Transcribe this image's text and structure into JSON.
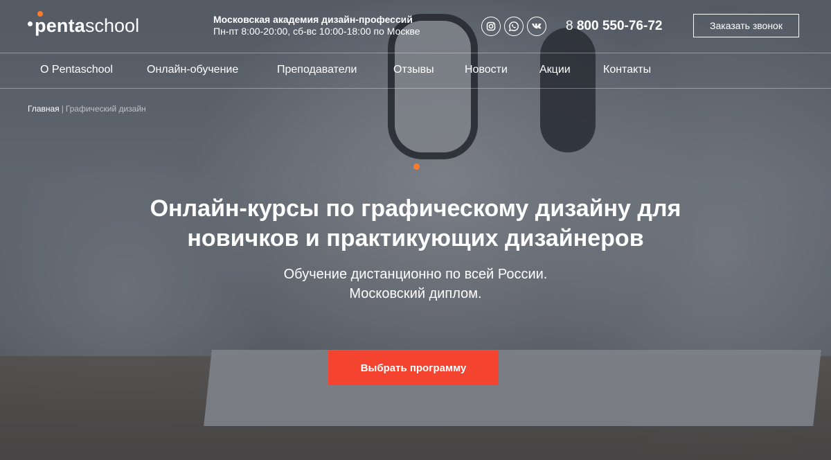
{
  "brand": {
    "logo_bold": "penta",
    "logo_light": "school",
    "accent_color": "#ff7a2a",
    "cta_color": "#f4432f"
  },
  "header": {
    "academy_title": "Московская академия дизайн-профессий",
    "schedule": "Пн-пт 8:00-20:00, сб-вс 10:00-18:00 по Москве",
    "social": [
      {
        "name": "instagram-icon"
      },
      {
        "name": "whatsapp-icon"
      },
      {
        "name": "vk-icon"
      }
    ],
    "phone_prefix": "8",
    "phone_number": "800 550-76-72",
    "callback_label": "Заказать звонок"
  },
  "nav": {
    "items": [
      "О Pentaschool",
      "Онлайн-обучение",
      "Преподаватели",
      "Отзывы",
      "Новости",
      "Акции",
      "Контакты"
    ]
  },
  "breadcrumbs": {
    "home": "Главная",
    "separator": "|",
    "current": "Графический дизайн"
  },
  "hero": {
    "title_line1": "Онлайн-курсы по графическому дизайну для",
    "title_line2": "новичков и практикующих дизайнеров",
    "subtitle_line1": "Обучение дистанционно по всей России.",
    "subtitle_line2": "Московский диплом.",
    "cta_label": "Выбрать программу"
  }
}
